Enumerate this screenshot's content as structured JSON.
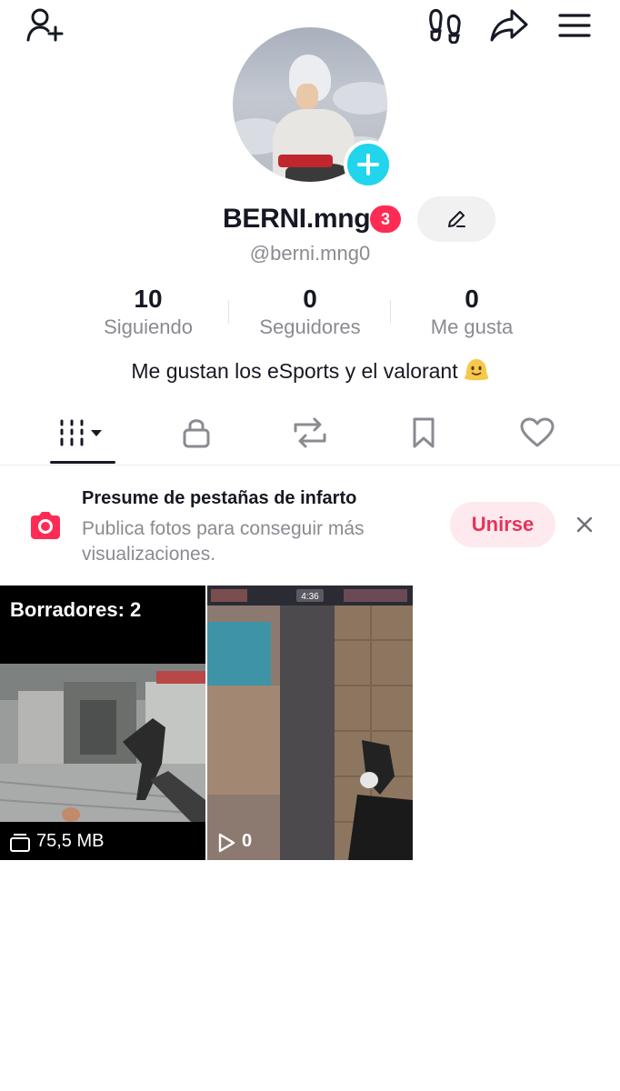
{
  "header": {
    "add_friend_icon": "person-plus-icon",
    "footprints_icon": "footprints-icon",
    "share_icon": "share-arrow-icon",
    "menu_icon": "hamburger-menu-icon"
  },
  "profile": {
    "username": "BERNI.mng",
    "notification_count": "3",
    "handle": "@berni.mng0",
    "bio": "Me gustan los eSports y el valorant",
    "bio_emoji": "melting-face-emoji"
  },
  "stats": [
    {
      "value": "10",
      "label": "Siguiendo"
    },
    {
      "value": "0",
      "label": "Seguidores"
    },
    {
      "value": "0",
      "label": "Me gusta"
    }
  ],
  "tabs": [
    {
      "icon": "grid-videos-icon",
      "active": true
    },
    {
      "icon": "lock-icon"
    },
    {
      "icon": "repost-icon"
    },
    {
      "icon": "bookmark-icon"
    },
    {
      "icon": "heart-icon"
    }
  ],
  "banner": {
    "title": "Presume de pestañas de infarto",
    "text": "Publica fotos para conseguir más visualizaciones.",
    "join_label": "Unirse"
  },
  "grid": {
    "drafts_label": "Borradores: 2",
    "drafts_size": "75,5 MB",
    "video_views": "0",
    "video_timer": "4:36"
  },
  "colors": {
    "accent_pink": "#fe2c55",
    "avatar_add": "#20d5ec",
    "join_bg": "#fde9ee",
    "join_text": "#e8325a"
  }
}
